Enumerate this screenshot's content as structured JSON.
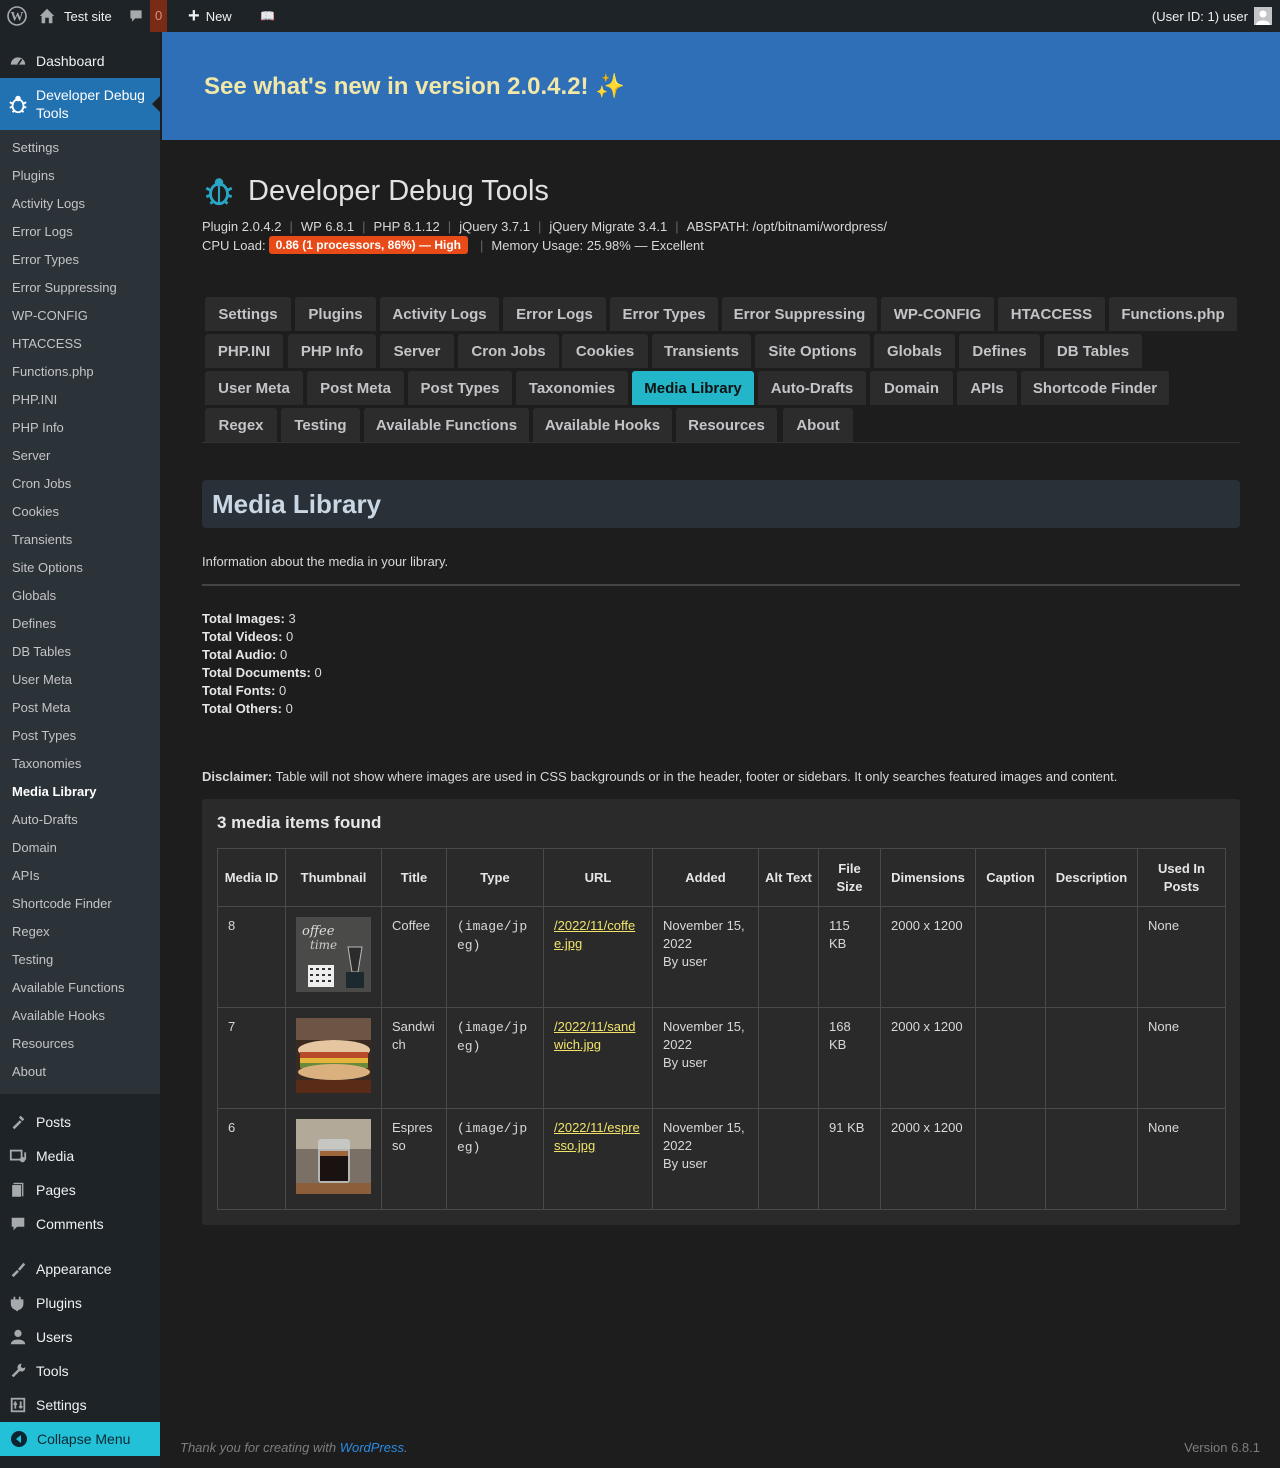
{
  "adminbar": {
    "site_name": "Test site",
    "comments_count": "0",
    "new_label": "New",
    "account": "(User ID: 1) user"
  },
  "sidebar": {
    "dashboard": "Dashboard",
    "current_plugin": "Developer Debug Tools",
    "submenu": [
      "Settings",
      "Plugins",
      "Activity Logs",
      "Error Logs",
      "Error Types",
      "Error Suppressing",
      "WP-CONFIG",
      "HTACCESS",
      "Functions.php",
      "PHP.INI",
      "PHP Info",
      "Server",
      "Cron Jobs",
      "Cookies",
      "Transients",
      "Site Options",
      "Globals",
      "Defines",
      "DB Tables",
      "User Meta",
      "Post Meta",
      "Post Types",
      "Taxonomies",
      "Media Library",
      "Auto-Drafts",
      "Domain",
      "APIs",
      "Shortcode Finder",
      "Regex",
      "Testing",
      "Available Functions",
      "Available Hooks",
      "Resources",
      "About"
    ],
    "current_submenu": "Media Library",
    "main_items": [
      "Posts",
      "Media",
      "Pages",
      "Comments",
      "Appearance",
      "Plugins",
      "Users",
      "Tools",
      "Settings"
    ],
    "collapse": "Collapse Menu"
  },
  "banner": {
    "title": "See what's new in version 2.0.4.2! ✨"
  },
  "header": {
    "title": "Developer Debug Tools",
    "plugin": "Plugin 2.0.4.2",
    "wp": "WP 6.8.1",
    "php": "PHP 8.1.12",
    "jquery": "jQuery 3.7.1",
    "jquery_migrate": "jQuery Migrate 3.4.1",
    "abspath": "ABSPATH: /opt/bitnami/wordpress/",
    "cpu_label": "CPU Load:",
    "cpu_badge": "0.86 (1 processors, 86%) — High",
    "memory": "Memory Usage: 25.98% — Excellent",
    "cpu_color": "#e84a18"
  },
  "tabs": [
    [
      "Settings",
      "Plugins",
      "Activity Logs",
      "Error Logs",
      "Error Types",
      "Error Suppressing",
      "WP-CONFIG",
      "HTACCESS",
      "Functions.php"
    ],
    [
      "PHP.INI",
      "PHP Info",
      "Server",
      "Cron Jobs",
      "Cookies",
      "Transients",
      "Site Options",
      "Globals",
      "Defines",
      "DB Tables"
    ],
    [
      "User Meta",
      "Post Meta",
      "Post Types",
      "Taxonomies",
      "Media Library",
      "Auto-Drafts",
      "Domain",
      "APIs",
      "Shortcode Finder"
    ],
    [
      "Regex",
      "Testing",
      "Available Functions",
      "Available Hooks",
      "Resources",
      "About"
    ]
  ],
  "active_tab": "Media Library",
  "section": {
    "title": "Media Library",
    "description": "Information about the media in your library.",
    "totals": [
      {
        "label": "Total Images:",
        "value": "3"
      },
      {
        "label": "Total Videos:",
        "value": "0"
      },
      {
        "label": "Total Audio:",
        "value": "0"
      },
      {
        "label": "Total Documents:",
        "value": "0"
      },
      {
        "label": "Total Fonts:",
        "value": "0"
      },
      {
        "label": "Total Others:",
        "value": "0"
      }
    ],
    "disclaimer_label": "Disclaimer:",
    "disclaimer_text": "Table will not show where images are used in CSS backgrounds or in the header, footer or sidebars. It only searches featured images and content."
  },
  "table": {
    "count_text": "3 media items found",
    "headers": [
      "Media ID",
      "Thumbnail",
      "Title",
      "Type",
      "URL",
      "Added",
      "Alt Text",
      "File Size",
      "Dimensions",
      "Caption",
      "Description",
      "Used In Posts"
    ],
    "rows": [
      {
        "id": "8",
        "thumb": "coffee-thumbnail",
        "title": "Coffee",
        "type": "(image/jpeg)",
        "url": "/2022/11/coffee.jpg",
        "added_date": "November 15, 2022",
        "added_by": "By user",
        "alt": "",
        "size": "115 KB",
        "dims": "2000 x 1200",
        "caption": "",
        "desc": "",
        "used": "None"
      },
      {
        "id": "7",
        "thumb": "sandwich-thumbnail",
        "title": "Sandwich",
        "type": "(image/jpeg)",
        "url": "/2022/11/sandwich.jpg",
        "added_date": "November 15, 2022",
        "added_by": "By user",
        "alt": "",
        "size": "168 KB",
        "dims": "2000 x 1200",
        "caption": "",
        "desc": "",
        "used": "None"
      },
      {
        "id": "6",
        "thumb": "espresso-thumbnail",
        "title": "Espresso",
        "type": "(image/jpeg)",
        "url": "/2022/11/espresso.jpg",
        "added_date": "November 15, 2022",
        "added_by": "By user",
        "alt": "",
        "size": "91 KB",
        "dims": "2000 x 1200",
        "caption": "",
        "desc": "",
        "used": "None"
      }
    ]
  },
  "footer": {
    "thanks_prefix": "Thank you for creating with",
    "thanks_link": "WordPress",
    "thanks_suffix": ".",
    "version": "Version 6.8.1"
  }
}
